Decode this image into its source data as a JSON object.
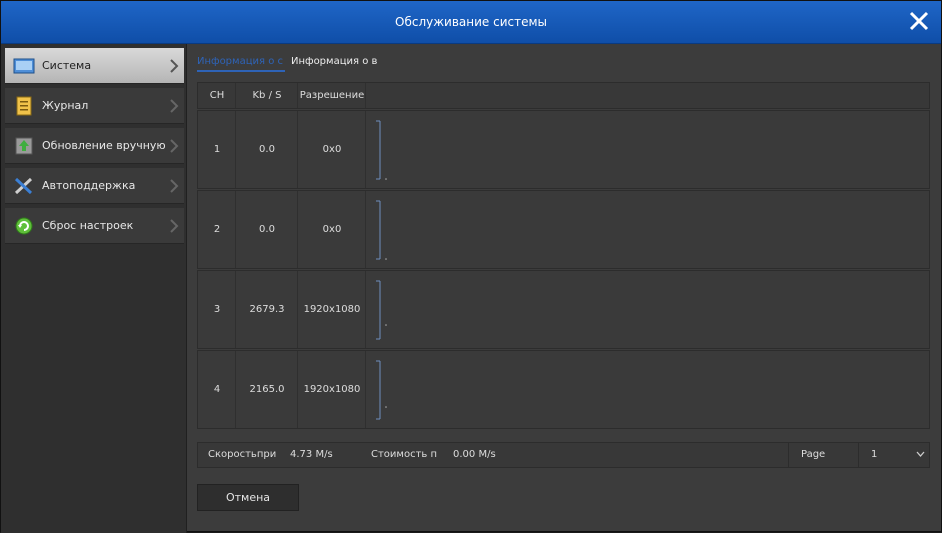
{
  "window": {
    "title": "Обслуживание системы"
  },
  "sidebar": {
    "items": [
      {
        "label": "Система",
        "icon": "system-icon",
        "active": true
      },
      {
        "label": "Журнал",
        "icon": "log-icon",
        "active": false
      },
      {
        "label": "Обновление вручную",
        "icon": "manual-update-icon",
        "active": false
      },
      {
        "label": "Автоподдержка",
        "icon": "tools-icon",
        "active": false
      },
      {
        "label": "Сброс настроек",
        "icon": "reset-icon",
        "active": false
      }
    ]
  },
  "tabs": [
    {
      "label": "Информация о с",
      "active": true
    },
    {
      "label": "Информация о в",
      "active": false
    }
  ],
  "table": {
    "headers": [
      "CH",
      "Kb / S",
      "Разрешение"
    ],
    "rows": [
      {
        "ch": "1",
        "kbps": "0.0",
        "res": "0x0"
      },
      {
        "ch": "2",
        "kbps": "0.0",
        "res": "0x0"
      },
      {
        "ch": "3",
        "kbps": "2679.3",
        "res": "1920x1080"
      },
      {
        "ch": "4",
        "kbps": "2165.0",
        "res": "1920x1080"
      }
    ]
  },
  "footer": {
    "speed_label": "Скоростьпри",
    "speed_value": "4.73 M/s",
    "cost_label": "Стоимость п",
    "cost_value": "0.00 M/s",
    "page_label": "Page",
    "page_value": "1"
  },
  "buttons": {
    "cancel": "Отмена"
  },
  "colors": {
    "titlebar": "#1f66c7",
    "accent": "#2e63b7",
    "panel": "#3c3c3c"
  }
}
